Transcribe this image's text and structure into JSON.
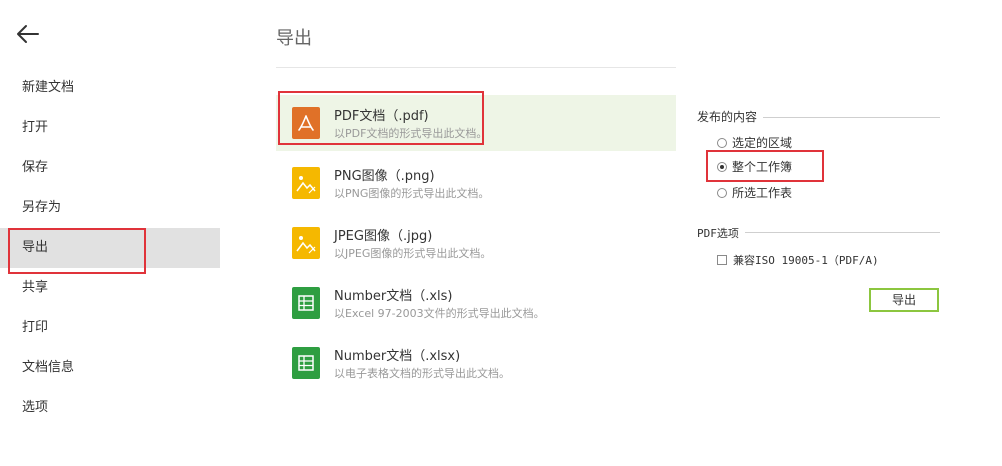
{
  "menu": {
    "items": [
      {
        "label": "新建文档"
      },
      {
        "label": "打开"
      },
      {
        "label": "保存"
      },
      {
        "label": "另存为"
      },
      {
        "label": "导出",
        "active": true
      },
      {
        "label": "共享"
      },
      {
        "label": "打印"
      },
      {
        "label": "文档信息"
      },
      {
        "label": "选项"
      }
    ]
  },
  "main": {
    "title": "导出",
    "formats": [
      {
        "name": "PDF文档（.pdf)",
        "desc": "以PDF文档的形式导出此文档。",
        "icon": "pdf-icon",
        "color": "#e07128",
        "selected": true
      },
      {
        "name": "PNG图像（.png)",
        "desc": "以PNG图像的形式导出此文档。",
        "icon": "image-icon",
        "color": "#f5b800"
      },
      {
        "name": "JPEG图像（.jpg)",
        "desc": "以JPEG图像的形式导出此文档。",
        "icon": "image-icon",
        "color": "#f5b800"
      },
      {
        "name": "Number文档（.xls)",
        "desc": "以Excel 97-2003文件的形式导出此文档。",
        "icon": "spreadsheet-icon",
        "color": "#2e9e41"
      },
      {
        "name": "Number文档（.xlsx)",
        "desc": "以电子表格文档的形式导出此文档。",
        "icon": "spreadsheet-icon",
        "color": "#2e9e41"
      }
    ]
  },
  "options": {
    "publish_label": "发布的内容",
    "scope": [
      {
        "label": "选定的区域",
        "checked": false
      },
      {
        "label": "整个工作簿",
        "checked": true
      },
      {
        "label": "所选工作表",
        "checked": false
      }
    ],
    "pdf_label": "PDF选项",
    "iso_label": "兼容ISO 19005-1（PDF/A)",
    "iso_checked": false,
    "export_label": "导出"
  },
  "colors": {
    "highlight": "#e0333a",
    "selected_bg": "#eef5e6",
    "button_border": "#8cc63f"
  }
}
